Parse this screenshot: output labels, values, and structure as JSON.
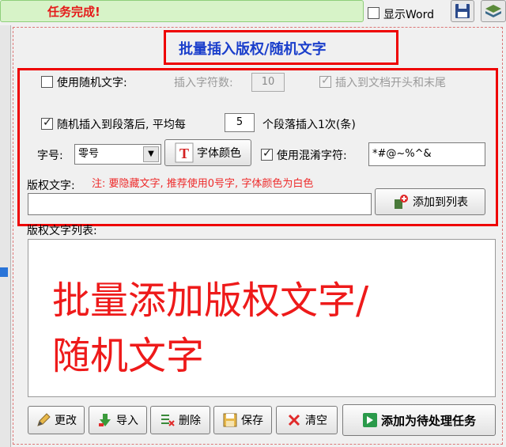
{
  "status": {
    "text": "任务完成!"
  },
  "top_bar": {
    "show_word_label": "显示Word",
    "show_word_checked": false
  },
  "panel": {
    "title": "批量插入版权/随机文字"
  },
  "options": {
    "use_random_text_label": "使用随机文字:",
    "use_random_text_checked": false,
    "insert_char_count_label": "插入字符数:",
    "insert_char_count_value": "10",
    "insert_head_tail_label": "插入到文档开头和末尾",
    "insert_head_tail_checked": true,
    "random_after_paragraph_label": "随机插入到段落后, 平均每",
    "random_after_paragraph_checked": true,
    "paragraph_interval_value": "5",
    "paragraph_interval_suffix": "个段落插入1次(条)",
    "font_size_label": "字号:",
    "font_size_value": "零号",
    "font_color_button": "字体颜色",
    "use_obfuscate_label": "使用混淆字符:",
    "use_obfuscate_checked": true,
    "obfuscate_value": "*#@~%^&"
  },
  "copyright": {
    "label": "版权文字:",
    "note": "注: 要隐藏文字, 推荐使用0号字, 字体颜色为白色",
    "input_value": "",
    "add_button": "添加到列表"
  },
  "list": {
    "label": "版权文字列表:",
    "overlay_line1": "批量添加版权文字/",
    "overlay_line2": "随机文字"
  },
  "bottom_buttons": {
    "modify": "更改",
    "import": "导入",
    "delete": "删除",
    "save": "保存",
    "clear": "清空",
    "add_task": "添加为待处理任务"
  },
  "colors": {
    "highlight_red": "#e00000",
    "title_blue": "#1a3ecb",
    "status_red": "#e51a1a"
  }
}
